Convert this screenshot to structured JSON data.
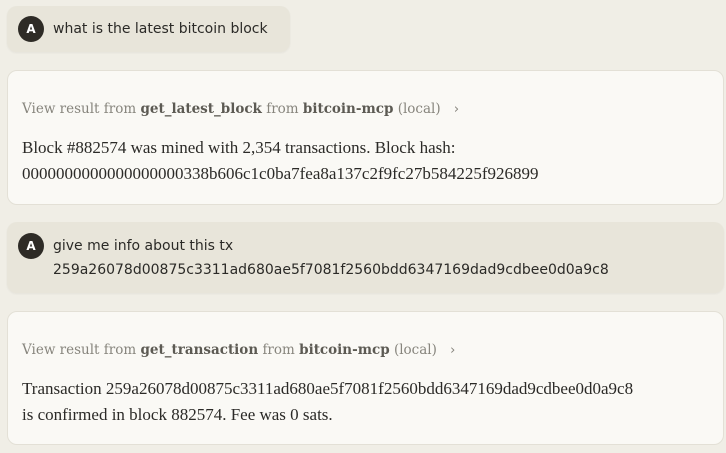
{
  "messages": [
    {
      "avatar": "A",
      "text_lines": [
        "what is the latest bitcoin block"
      ]
    },
    {
      "tool_prefix": "View result from",
      "tool_name": "get_latest_block",
      "from_word": "from",
      "server": "bitcoin-mcp",
      "scope": "(local)",
      "answer_lines": [
        "Block #882574 was mined with 2,354 transactions. Block hash:",
        "0000000000000000000338b606c1c0ba7fea8a137c2f9fc27b584225f926899"
      ]
    },
    {
      "avatar": "A",
      "text_lines": [
        "give me info about this tx",
        "259a26078d00875c3311ad680ae5f7081f2560bdd6347169dad9cdbee0d0a9c8"
      ]
    },
    {
      "tool_prefix": "View result from",
      "tool_name": "get_transaction",
      "from_word": "from",
      "server": "bitcoin-mcp",
      "scope": "(local)",
      "answer_lines": [
        "Transaction 259a26078d00875c3311ad680ae5f7081f2560bdd6347169dad9cdbee0d0a9c8",
        "is confirmed in block 882574. Fee was 0 sats."
      ]
    }
  ],
  "icons": {
    "chevron": "›"
  },
  "colors": {
    "background": "#f0eee6",
    "user_bubble": "#e8e5da",
    "assistant_card": "#faf9f5",
    "avatar": "#2e2b26",
    "muted_text": "#87857d"
  }
}
